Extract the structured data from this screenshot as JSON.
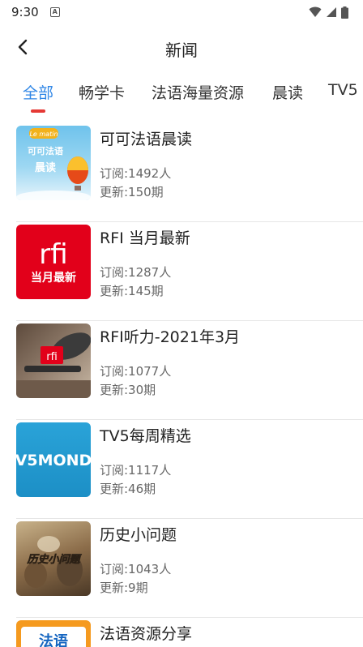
{
  "status": {
    "time": "9:30",
    "notification_icon": "A"
  },
  "header": {
    "title": "新闻",
    "back_icon": "chevron-left-icon"
  },
  "tabs": [
    {
      "label": "全部",
      "active": true
    },
    {
      "label": "畅学卡",
      "active": false
    },
    {
      "label": "法语海量资源",
      "active": false
    },
    {
      "label": "晨读",
      "active": false
    },
    {
      "label": "TV5",
      "active": false
    }
  ],
  "items": [
    {
      "title": "可可法语晨读",
      "subscribers": "订阅:1492人",
      "updates": "更新:150期",
      "thumb": {
        "badge": "Le matin",
        "line1": "可可法语",
        "line2": "晨读"
      }
    },
    {
      "title": "RFI 当月最新",
      "subscribers": "订阅:1287人",
      "updates": "更新:145期",
      "thumb": {
        "logo": "rfi",
        "caption": "当月最新"
      }
    },
    {
      "title": "RFI听力-2021年3月",
      "subscribers": "订阅:1077人",
      "updates": "更新:30期",
      "thumb": {
        "logo": "rfi"
      }
    },
    {
      "title": "TV5每周精选",
      "subscribers": "订阅:1117人",
      "updates": "更新:46期",
      "thumb": {
        "text": "V5MOND"
      }
    },
    {
      "title": "历史小问题",
      "subscribers": "订阅:1043人",
      "updates": "更新:9期",
      "thumb": {
        "text": "历史小问题"
      }
    },
    {
      "title": "法语资源分享",
      "subscribers": "",
      "updates": "",
      "thumb": {
        "text": "法语"
      }
    }
  ],
  "colors": {
    "accent": "#2f86e6",
    "indicator": "#e53935",
    "rfi_red": "#e2001a",
    "tv5_blue": "#1c8fc6"
  }
}
